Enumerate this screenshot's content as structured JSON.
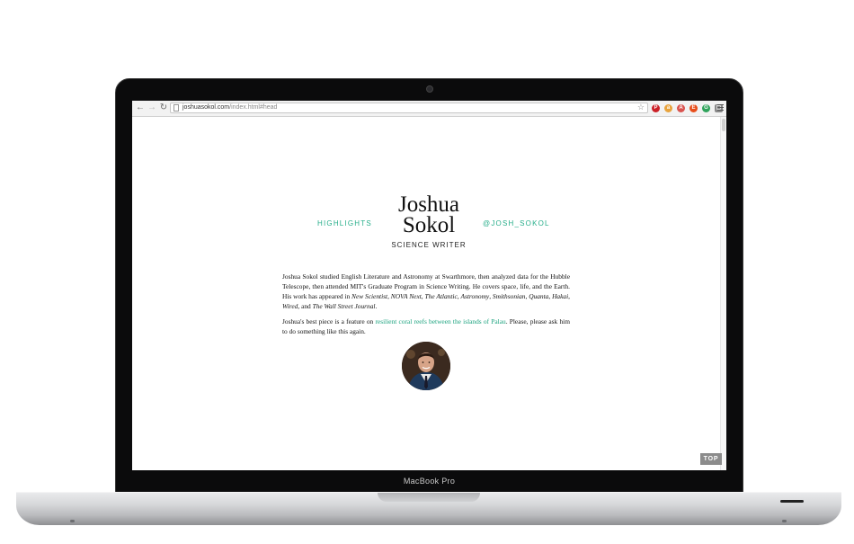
{
  "browser": {
    "url_host": "joshuasokol.com",
    "url_path": "/index.html#head",
    "back_icon": "arrow-left-icon",
    "forward_icon": "arrow-right-icon",
    "reload_icon": "reload-icon",
    "extensions": [
      {
        "name": "pinterest-icon",
        "glyph": "P",
        "color": "#cb2027"
      },
      {
        "name": "amazon-icon",
        "glyph": "a",
        "color": "#e8a33d"
      },
      {
        "name": "adblock-icon",
        "glyph": "A",
        "color": "#d9534f"
      },
      {
        "name": "evernote-icon",
        "glyph": "E",
        "color": "#e84e1b"
      },
      {
        "name": "grammar-icon",
        "glyph": "G",
        "color": "#2fa35b"
      },
      {
        "name": "page-icon",
        "glyph": "▢",
        "color": "#8a8a8a"
      }
    ]
  },
  "header": {
    "name_line1": "Joshua",
    "name_line2": "Sokol",
    "subtitle": "SCIENCE WRITER",
    "left_link": "HIGHLIGHTS",
    "right_link": "@JOSH_SOKOL"
  },
  "bio": {
    "p1_text": "Joshua Sokol studied English Literature and Astronomy at Swarthmore, then analyzed data for the Hubble Telescope, then attended MIT's Graduate Program in Science Writing. He covers space, life, and the Earth. His work has appeared in",
    "pubs": [
      "New Scientist",
      "NOVA Next",
      "The Atlantic",
      "Astronomy",
      "Smithsonian",
      "Quanta",
      "Hakai",
      "Wired",
      "The Wall Street Journal"
    ],
    "p2_before": "Joshua's best piece is a feature on ",
    "p2_link": "resilient coral reefs between the islands of Palau",
    "p2_after": ". Please, please ask him to do something like this again."
  },
  "laptop_label": "MacBook Pro",
  "top_button": "TOP",
  "accent_color": "#27ae8a"
}
